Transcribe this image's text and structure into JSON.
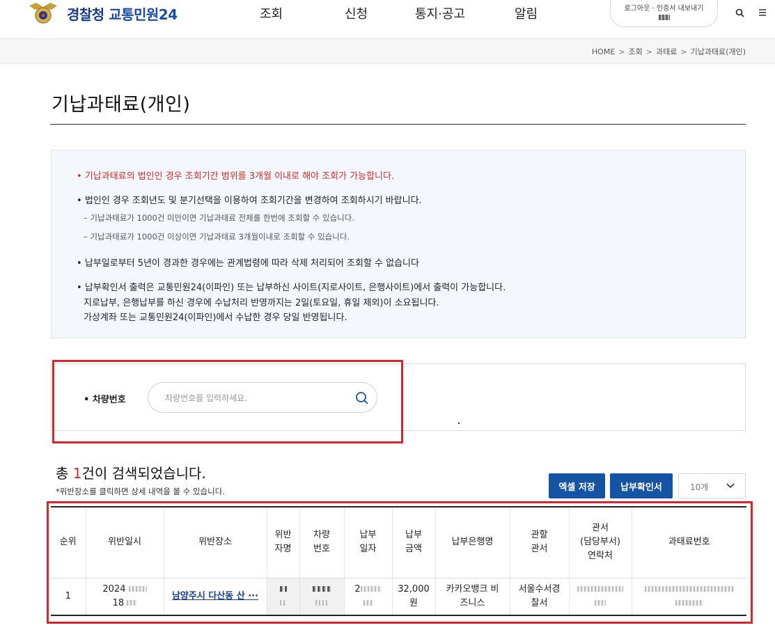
{
  "header": {
    "logo_part1": "경찰청",
    "logo_part2": "교통민원24",
    "nav": [
      "조회",
      "신청",
      "통지·공고",
      "알림"
    ],
    "login_links": "로그아웃 · 인증서 내보내기"
  },
  "breadcrumb": [
    "HOME",
    "조회",
    "과태료",
    "기납과태료(개인)"
  ],
  "page_title": "기납과태료(개인)",
  "notice": {
    "red_line": "기납과태료의 법인인 경우 조회기간 범위를 3개월 이내로 해야 조회가 가능합니다.",
    "line2": "법인인 경우 조회년도 및 분기선택을 이용하여 조회기간을 변경하여 조회하시기 바랍니다.",
    "sub1": "기납과태료가 1000건 미만이면 기납과태료 전체를 한번에 조회할 수 있습니다.",
    "sub2": "기납과태료가 1000건 이상이면 기납과태료 3개월이내로 조회할 수 있습니다.",
    "line3": "납부일로부터 5년이 경과한 경우에는 관계법령에 따라 삭제 처리되어 조회할 수 없습니다",
    "line4a": "납부확인서 출력은 교통민원24(이파인) 또는 납부하신 사이트(지로사이트, 은행사이트)에서 출력이 가능합니다.",
    "line4b": "지로납부, 은행납부를 하신 경우에 수납처리 반영까지는 2일(토요일, 휴일 제외)이 소요됩니다.",
    "line4c": "가상계좌 또는 교통민원24(이파인)에서 수납한 경우 당일 반영됩니다."
  },
  "search": {
    "label": "차량번호",
    "placeholder": "차량번호를 입력하세요."
  },
  "results": {
    "prefix": "총 ",
    "count": "1",
    "suffix": "건이 검색되었습니다.",
    "hint": "*위반장소를 클릭하면 상세 내역을 볼 수 있습니다.",
    "excel_button": "엑셀 저장",
    "confirm_button": "납부확인서",
    "page_size": "10개"
  },
  "table": {
    "headers": {
      "no": "순위",
      "date": "위반일시",
      "place": "위반장소",
      "violator_1": "위반",
      "violator_2": "자명",
      "car_1": "차량",
      "car_2": "번호",
      "paydate_1": "납부",
      "paydate_2": "일자",
      "amount_1": "납부",
      "amount_2": "금액",
      "bank": "납부은행명",
      "office_1": "관할",
      "office_2": "관서",
      "contact_1": "관서",
      "contact_2": "(담당부서)",
      "contact_3": "연락처",
      "fine_no": "과태료번호"
    },
    "row": {
      "no": "1",
      "date_prefix": "2024",
      "date_line2": "18",
      "place": "남양주시 다산동 산 ···",
      "paydate_prefix": "2",
      "amount_1": "32,000",
      "amount_2": "원",
      "bank_1": "카카오뱅크 비",
      "bank_2": "즈니스",
      "office_1": "서울수서경",
      "office_2": "찰서"
    }
  },
  "colors": {
    "primary": "#1554a4",
    "highlight": "#d9242a",
    "notice_red": "#d32b2b"
  }
}
